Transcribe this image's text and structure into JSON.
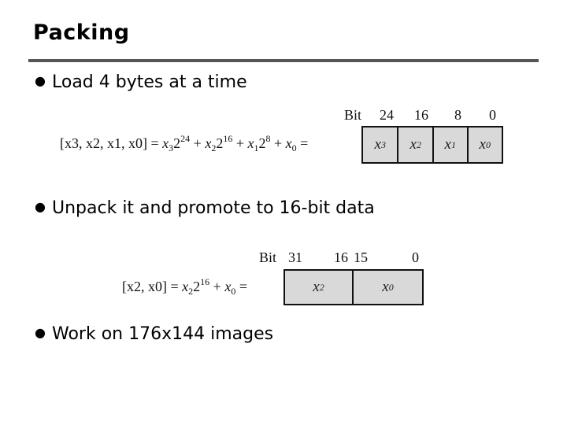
{
  "title": "Packing",
  "bullets": [
    "Load 4 bytes at a time",
    "Unpack it and promote to 16-bit data",
    "Work on 176x144 images"
  ],
  "figure1": {
    "lhs": "[x3, x2, x1, x0]",
    "bit_label": "Bit",
    "bit_positions": [
      "24",
      "16",
      "8",
      "0"
    ],
    "cells": [
      {
        "var": "x",
        "sub": "3"
      },
      {
        "var": "x",
        "sub": "2"
      },
      {
        "var": "x",
        "sub": "1"
      },
      {
        "var": "x",
        "sub": "0"
      }
    ],
    "cell_fill": "#d9d9d9"
  },
  "figure2": {
    "lhs": "[x2, x0]",
    "bit_label": "Bit",
    "bit_positions": [
      "31",
      "16",
      "15",
      "0"
    ],
    "cells": [
      {
        "var": "x",
        "sub": "2"
      },
      {
        "var": "x",
        "sub": "0"
      }
    ],
    "cell_fill": "#d9d9d9"
  },
  "math": {
    "eq": "=",
    "plus": "+",
    "base": "2",
    "x": "x",
    "exp24": "24",
    "exp16": "16",
    "exp8": "8",
    "s3": "3",
    "s2": "2",
    "s1": "1",
    "s0": "0"
  }
}
